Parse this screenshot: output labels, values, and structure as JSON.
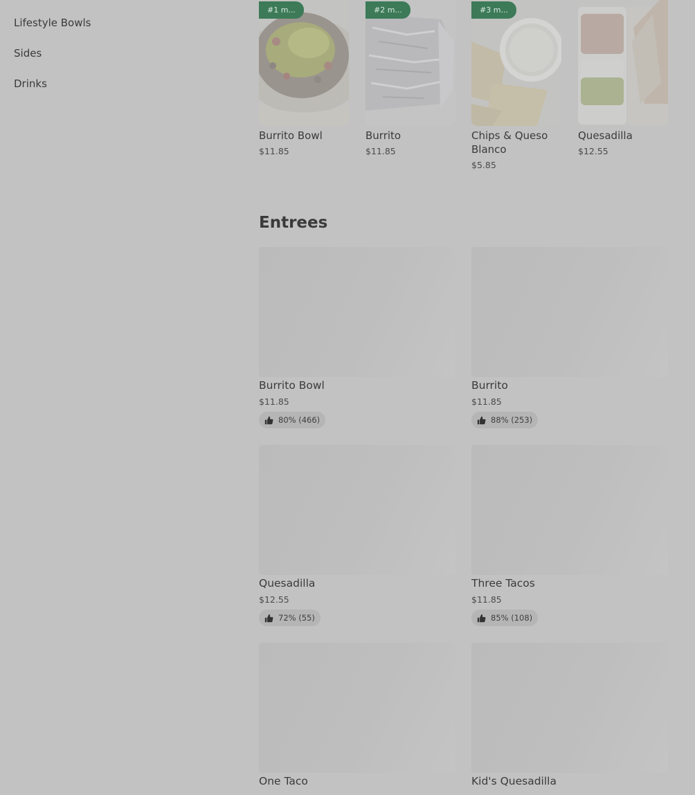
{
  "sidebar": {
    "items": [
      {
        "label": "Lifestyle Bowls"
      },
      {
        "label": "Sides"
      },
      {
        "label": "Drinks"
      }
    ]
  },
  "popular": {
    "items": [
      {
        "badge": "#1 m...",
        "name": "Burrito Bowl",
        "price": "$11.85",
        "image": "burrito-bowl-photo"
      },
      {
        "badge": "#2 m...",
        "name": "Burrito",
        "price": "$11.85",
        "image": "foil-burrito-photo"
      },
      {
        "badge": "#3 m...",
        "name": "Chips & Queso Blanco",
        "price": "$5.85",
        "image": "chips-queso-photo"
      },
      {
        "badge": "",
        "name": "Quesadilla",
        "price": "$12.55",
        "image": "quesadilla-photo"
      }
    ]
  },
  "entrees": {
    "title": "Entrees",
    "items": [
      {
        "name": "Burrito Bowl",
        "price": "$11.85",
        "rating": "80% (466)"
      },
      {
        "name": "Burrito",
        "price": "$11.85",
        "rating": "88% (253)"
      },
      {
        "name": "Quesadilla",
        "price": "$12.55",
        "rating": "72% (55)"
      },
      {
        "name": "Three Tacos",
        "price": "$11.85",
        "rating": "85% (108)"
      },
      {
        "name": "One Taco",
        "price": "",
        "rating": ""
      },
      {
        "name": "Kid's Quesadilla",
        "price": "",
        "rating": ""
      }
    ]
  },
  "colors": {
    "overlay": "#c2c2c2",
    "badge": "#3c7a58",
    "text": "#3a3a3a"
  }
}
